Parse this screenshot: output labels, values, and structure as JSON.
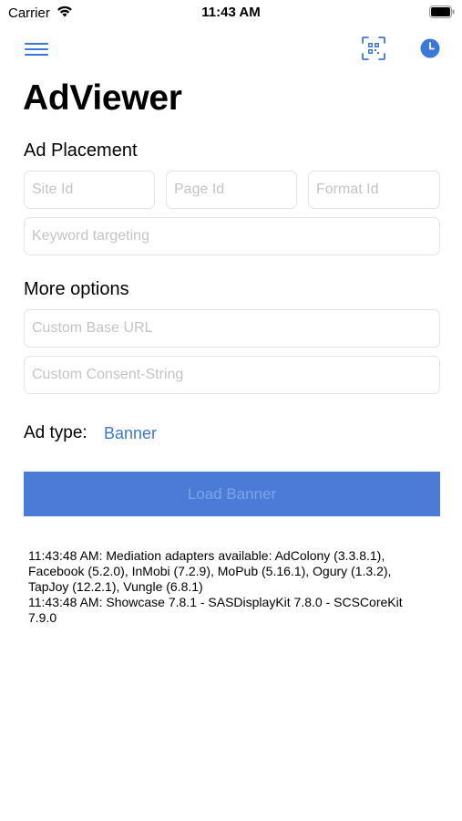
{
  "status_bar": {
    "carrier": "Carrier",
    "time": "11:43 AM"
  },
  "nav": {
    "menu_icon": "hamburger-menu-icon",
    "qr_icon": "qr-code-scan-icon",
    "history_icon": "clock-icon",
    "accent_color": "#3b78d8"
  },
  "title": "AdViewer",
  "ad_placement": {
    "heading": "Ad Placement",
    "site_id_placeholder": "Site Id",
    "page_id_placeholder": "Page Id",
    "format_id_placeholder": "Format Id",
    "keyword_placeholder": "Keyword targeting"
  },
  "more_options": {
    "heading": "More options",
    "base_url_placeholder": "Custom Base URL",
    "consent_placeholder": "Custom Consent-String"
  },
  "ad_type": {
    "label": "Ad type:",
    "value": "Banner"
  },
  "load_button": {
    "label": "Load Banner",
    "background": "#4a7bd6"
  },
  "log": [
    "11:43:48 AM: Mediation adapters available: AdColony (3.3.8.1), Facebook (5.2.0), InMobi (7.2.9), MoPub (5.16.1), Ogury (1.3.2), TapJoy (12.2.1), Vungle (6.8.1)",
    "11:43:48 AM: Showcase 7.8.1 - SASDisplayKit 7.8.0 - SCSCoreKit 7.9.0"
  ]
}
